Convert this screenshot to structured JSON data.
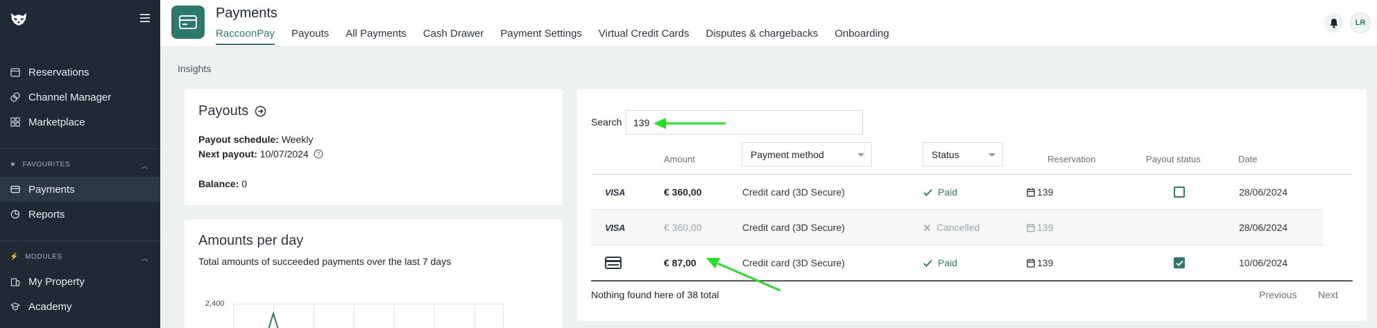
{
  "sidebar": {
    "nav_top": [
      {
        "label": "Reservations",
        "icon": "calendar-icon"
      },
      {
        "label": "Channel Manager",
        "icon": "channel-icon"
      },
      {
        "label": "Marketplace",
        "icon": "grid-icon"
      }
    ],
    "favourites_label": "FAVOURITES",
    "favourites": [
      {
        "label": "Payments",
        "icon": "card-icon",
        "active": true
      },
      {
        "label": "Reports",
        "icon": "pie-chart-icon"
      }
    ],
    "modules_label": "MODULES",
    "modules": [
      {
        "label": "My Property",
        "icon": "building-icon"
      },
      {
        "label": "Academy",
        "icon": "academy-icon"
      }
    ]
  },
  "header": {
    "title": "Payments",
    "tabs": [
      "RaccoonPay",
      "Payouts",
      "All Payments",
      "Cash Drawer",
      "Payment Settings",
      "Virtual Credit Cards",
      "Disputes & chargebacks",
      "Onboarding"
    ],
    "active_tab": "RaccoonPay",
    "avatar_initials": "LR"
  },
  "insights_label": "Insights",
  "payouts_card": {
    "title": "Payouts",
    "schedule_label": "Payout schedule:",
    "schedule_value": "Weekly",
    "next_label": "Next payout:",
    "next_value": "10/07/2024",
    "balance_label": "Balance:",
    "balance_value": "0"
  },
  "amounts_card": {
    "title": "Amounts per day",
    "subtitle": "Total amounts of succeeded payments over the last 7 days",
    "y_tick": "2,400"
  },
  "table": {
    "search_label": "Search",
    "search_value": "139",
    "columns": {
      "amount": "Amount",
      "payment_method": "Payment method",
      "status": "Status",
      "reservation": "Reservation",
      "payout_status": "Payout status",
      "date": "Date"
    },
    "rows": [
      {
        "brand": "VISA",
        "amount": "€ 360,00",
        "method": "Credit card (3D Secure)",
        "status": "Paid",
        "reservation": "139",
        "payout_checked": false,
        "date": "28/06/2024",
        "muted": false
      },
      {
        "brand": "VISA",
        "amount": "€ 360,00",
        "method": "Credit card (3D Secure)",
        "status": "Cancelled",
        "reservation": "139",
        "payout_checked": null,
        "date": "28/06/2024",
        "muted": true
      },
      {
        "brand": "card",
        "amount": "€ 87,00",
        "method": "Credit card (3D Secure)",
        "status": "Paid",
        "reservation": "139",
        "payout_checked": true,
        "date": "10/06/2024",
        "muted": false
      }
    ],
    "footer": "Nothing found here of 38 total",
    "previous": "Previous",
    "next": "Next"
  },
  "colors": {
    "accent": "#2d7a6d",
    "sidebar_bg": "#1f2a35",
    "annotation_arrow": "#22e022"
  }
}
